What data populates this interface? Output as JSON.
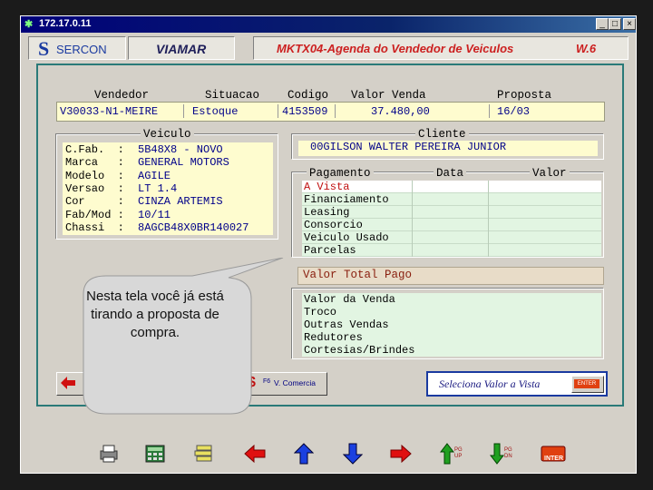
{
  "window": {
    "title": "172.17.0.11",
    "minimize": "_",
    "maximize": "□",
    "close": "×"
  },
  "header": {
    "brand": "SERCON",
    "company": "VIAMAR",
    "screen_title": "MKTX04-Agenda do Vendedor de Veiculos",
    "version": "W.6"
  },
  "top": {
    "headers": {
      "vendedor": "Vendedor",
      "situacao": "Situacao",
      "codigo": "Codigo",
      "valor_venda": "Valor Venda",
      "proposta": "Proposta"
    },
    "values": {
      "vendedor": "V30033-N1-MEIRE",
      "situacao": "Estoque",
      "codigo": "4153509",
      "valor_venda": "37.480,00",
      "proposta": "16/03"
    }
  },
  "veiculo": {
    "title": "Veiculo",
    "rows": [
      {
        "label": "C.Fab.  :",
        "value": "5B48X8 - NOVO"
      },
      {
        "label": "Marca   :",
        "value": "GENERAL MOTORS"
      },
      {
        "label": "Modelo  :",
        "value": "AGILE"
      },
      {
        "label": "Versao  :",
        "value": "LT 1.4"
      },
      {
        "label": "Cor     :",
        "value": "CINZA ARTEMIS"
      },
      {
        "label": "Fab/Mod :",
        "value": "10/11"
      },
      {
        "label": "Chassi  :",
        "value": "8AGCB48X0BR140027"
      }
    ]
  },
  "cliente": {
    "title": "Cliente",
    "name": "00GILSON WALTER PEREIRA JUNIOR"
  },
  "pagamento": {
    "headers": {
      "pagamento": "Pagamento",
      "data": "Data",
      "valor": "Valor"
    },
    "items": [
      "A Vista",
      "Financiamento",
      "Leasing",
      "Consorcio",
      "Veiculo Usado",
      "Parcelas"
    ],
    "total_label": "Valor Total Pago"
  },
  "resumo": {
    "items": [
      "Valor da Venda",
      "Troco",
      "Outras Vendas",
      "Redutores",
      "Cortesias/Brindes"
    ]
  },
  "buttons": {
    "f6_key": "F6",
    "f6_label": "V. Comercia",
    "dollar": "$"
  },
  "status": {
    "message": "Seleciona Valor a Vista",
    "enter_key": "ENTER"
  },
  "callout": {
    "text": "Nesta tela você já está tirando a proposta de compra."
  },
  "toolbar": {
    "pgup": "PG UP",
    "pgdn": "PG DN",
    "inter": "INTER"
  },
  "colors": {
    "title_bar": "#0a246a",
    "border_teal": "#2a7a78",
    "value_blue": "#00008a",
    "field_yellow": "#fefccf",
    "field_green": "#e2f5e2",
    "highlight": "#ffffff",
    "header_red": "#cc2020"
  }
}
